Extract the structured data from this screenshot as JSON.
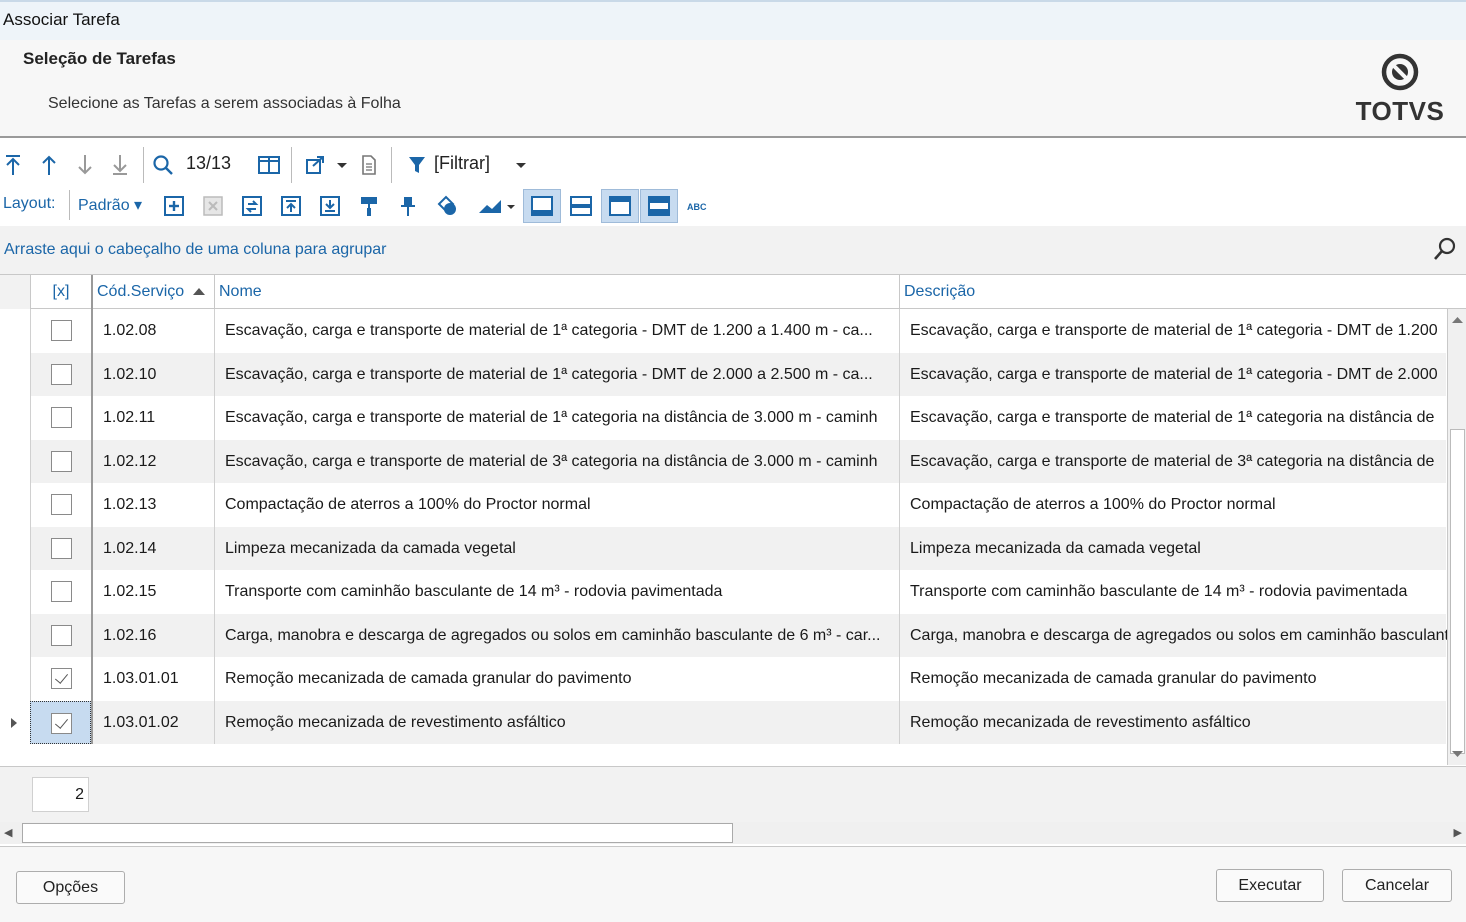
{
  "window": {
    "title": "Associar Tarefa"
  },
  "header": {
    "title": "Seleção de Tarefas",
    "subtitle": "Selecione as Tarefas a serem associadas à Folha",
    "logo_text": "TOTVS"
  },
  "toolbar": {
    "record_counter": "13/13",
    "filter_label": "[Filtrar]",
    "layout_label": "Layout:",
    "layout_value": "Padrão"
  },
  "groupbar": {
    "hint": "Arraste aqui o cabeçalho de uma coluna para agrupar"
  },
  "grid": {
    "columns": {
      "check": "[x]",
      "code": "Cód.Serviço",
      "name": "Nome",
      "description": "Descrição"
    },
    "sort": {
      "column": "Cód.Serviço",
      "direction": "asc"
    },
    "rows": [
      {
        "checked": false,
        "code": "1.02.08",
        "name": "Escavação, carga e transporte de material de 1ª categoria - DMT de 1.200 a 1.400 m - ca...",
        "description": "Escavação, carga e transporte de material de 1ª categoria - DMT de 1.200"
      },
      {
        "checked": false,
        "code": "1.02.10",
        "name": "Escavação, carga e transporte de material de 1ª categoria - DMT de 2.000 a 2.500 m - ca...",
        "description": "Escavação, carga e transporte de material de 1ª categoria - DMT de 2.000"
      },
      {
        "checked": false,
        "code": "1.02.11",
        "name": "Escavação, carga e transporte de material de 1ª categoria na distância de 3.000 m - caminh",
        "description": "Escavação, carga e transporte de material de 1ª categoria na distância de"
      },
      {
        "checked": false,
        "code": "1.02.12",
        "name": "Escavação, carga e transporte de material de 3ª categoria na distância de 3.000 m - caminh",
        "description": "Escavação, carga e transporte de material de 3ª categoria na distância de"
      },
      {
        "checked": false,
        "code": "1.02.13",
        "name": "Compactação de aterros a 100% do Proctor normal",
        "description": "Compactação de aterros a 100% do Proctor normal"
      },
      {
        "checked": false,
        "code": "1.02.14",
        "name": "Limpeza mecanizada da camada vegetal",
        "description": "Limpeza mecanizada da camada vegetal"
      },
      {
        "checked": false,
        "code": "1.02.15",
        "name": "Transporte com caminhão basculante de 14 m³ - rodovia pavimentada",
        "description": "Transporte com caminhão basculante de 14 m³ - rodovia pavimentada"
      },
      {
        "checked": false,
        "code": "1.02.16",
        "name": "Carga, manobra e descarga de agregados ou solos em caminhão basculante de 6 m³ - car...",
        "description": "Carga, manobra e descarga de agregados ou solos em caminhão basculant"
      },
      {
        "checked": true,
        "code": "1.03.01.01",
        "name": "Remoção mecanizada de camada granular do pavimento",
        "description": "Remoção mecanizada de camada granular do pavimento"
      },
      {
        "checked": true,
        "code": "1.03.01.02",
        "name": "Remoção mecanizada de revestimento asfáltico",
        "description": "Remoção mecanizada de revestimento asfáltico",
        "current": true
      }
    ],
    "summary_count": "2"
  },
  "buttons": {
    "options": "Opções",
    "execute": "Executar",
    "cancel": "Cancelar"
  },
  "colors": {
    "accent": "#1b66a8",
    "row_alt": "#f1f1f1",
    "toggle_active": "#c7dbf0"
  }
}
